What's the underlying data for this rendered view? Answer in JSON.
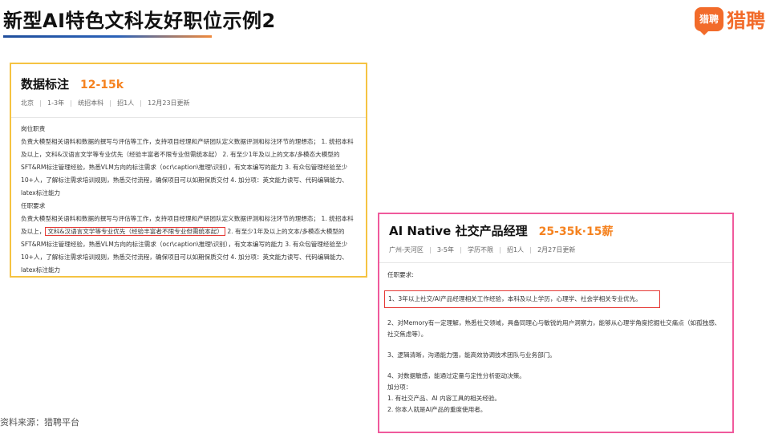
{
  "header": {
    "title": "新型AI特色文科友好职位示例2",
    "logo_badge": "猎聘",
    "logo_text": "猎聘"
  },
  "job1": {
    "title": "数据标注",
    "salary": "12-15k",
    "meta": [
      "北京",
      "1-3年",
      "统招本科",
      "招1人",
      "12月23日更新"
    ],
    "section_duty": "岗位职责",
    "duty_text": "负责大模型相关语料和数据的撰写与评估等工作，支持项目经理和产研团队定义数据评测和标注环节的理想态； 1. 统招本科及以上，文科&汉语言文学等专业优先（经验丰富者不限专业但需统本起） 2. 有至少1年及以上的文本/多模态大模型的SFT&RM标注管理经验，熟悉VLM方向的标注需求（ocr\\caption\\推理\\识别），有文本编写的能力 3. 有众包管理经验至少10+人，了解标注需求培训规则，熟悉交付流程，确保项目可以如期保质交付 4. 加分项：英文能力读写、代码编辑能力、latex标注能力",
    "section_req": "任职要求",
    "req_pre": "负责大模型相关语料和数据的撰写与评估等工作，支持项目经理和产研团队定义数据评测和标注环节的理想态； 1. 统招本科及以上，",
    "req_highlight": "文科&汉语言文学等专业优先（经验丰富者不限专业但需统本起）",
    "req_post": " 2. 有至少1年及以上的文本/多模态大模型的SFT&RM标注管理经验，熟悉VLM方向的标注需求（ocr\\caption\\推理\\识别），有文本编写的能力 3. 有众包管理经验至少10+人，了解标注需求培训规则，熟悉交付流程，确保项目可以如期保质交付 4. 加分项：英文能力读写、代码编辑能力、latex标注能力"
  },
  "job2": {
    "title": "AI Native 社交产品经理",
    "salary": "25-35k·15薪",
    "meta": [
      "广州-天河区",
      "3-5年",
      "学历不限",
      "招1人",
      "2月27日更新"
    ],
    "req_label": "任职要求:",
    "item1": "1、3年以上社交/AI产品经理相关工作经验，本科及以上学历，心理学、社会学相关专业优先。",
    "item2": "2、对Memory有一定理解，熟悉社交领域，具备同理心与敏锐的用户洞察力，能够从心理学角度挖掘社交痛点（如孤独感、社交焦虑等）。",
    "item3": "3、逻辑清晰，沟通能力强，能高效协调技术团队与业务部门。",
    "item4": "4、对数据敏感，能通过定量与定性分析驱动决策。",
    "bonus_label": "加分项：",
    "bonus1": "1. 有社交产品、AI 内容工具的相关经验。",
    "bonus2": "2. 你本人就是AI产品的重度使用者。"
  },
  "footer": {
    "source": "资料来源：猎聘平台"
  }
}
